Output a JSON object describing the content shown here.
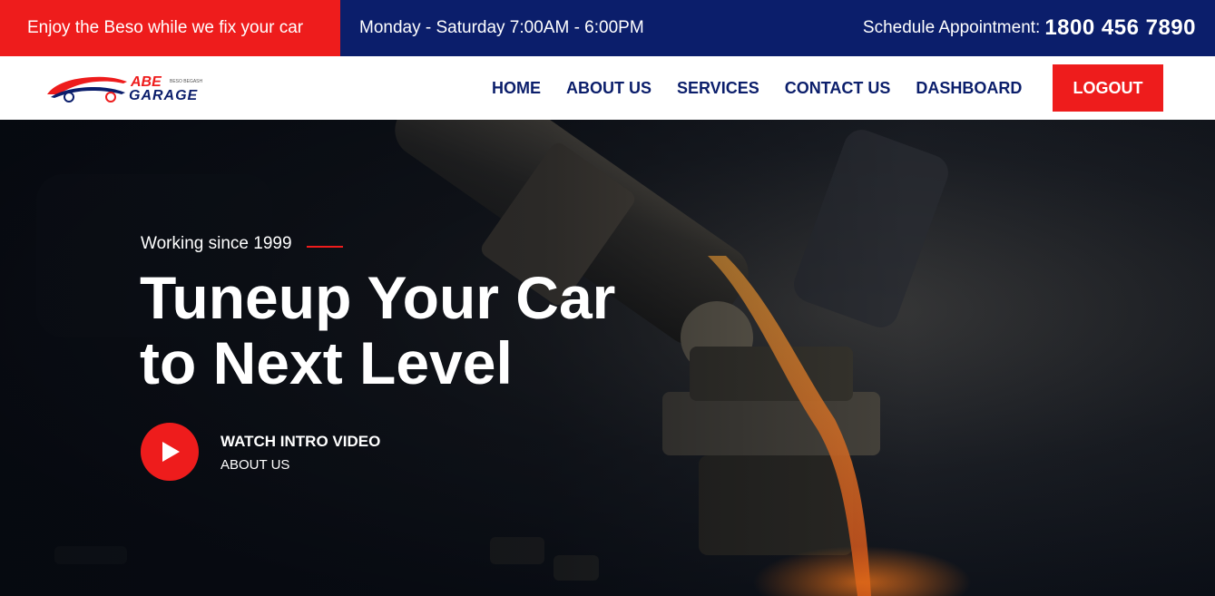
{
  "topbar": {
    "promo": "Enjoy the Beso while we fix your car",
    "hours": "Monday - Saturday 7:00AM - 6:00PM",
    "schedule_label": "Schedule Appointment:",
    "phone": "1800 456 7890"
  },
  "logo": {
    "line1": "ABE",
    "line2": "GARAGE",
    "tagline": "BESO BEGASH",
    "icon": "car-icon"
  },
  "nav": {
    "items": [
      "HOME",
      "ABOUT US",
      "SERVICES",
      "CONTACT US",
      "DASHBOARD"
    ],
    "logout": "LOGOUT"
  },
  "hero": {
    "kicker": "Working since 1999",
    "headline_1": "Tuneup Your Car",
    "headline_2": "to Next Level",
    "video_title": "WATCH INTRO VIDEO",
    "video_sub": "ABOUT US",
    "play_icon": "play-icon"
  },
  "colors": {
    "accent": "#ee1c1c",
    "brand_navy": "#0b1e6b"
  }
}
